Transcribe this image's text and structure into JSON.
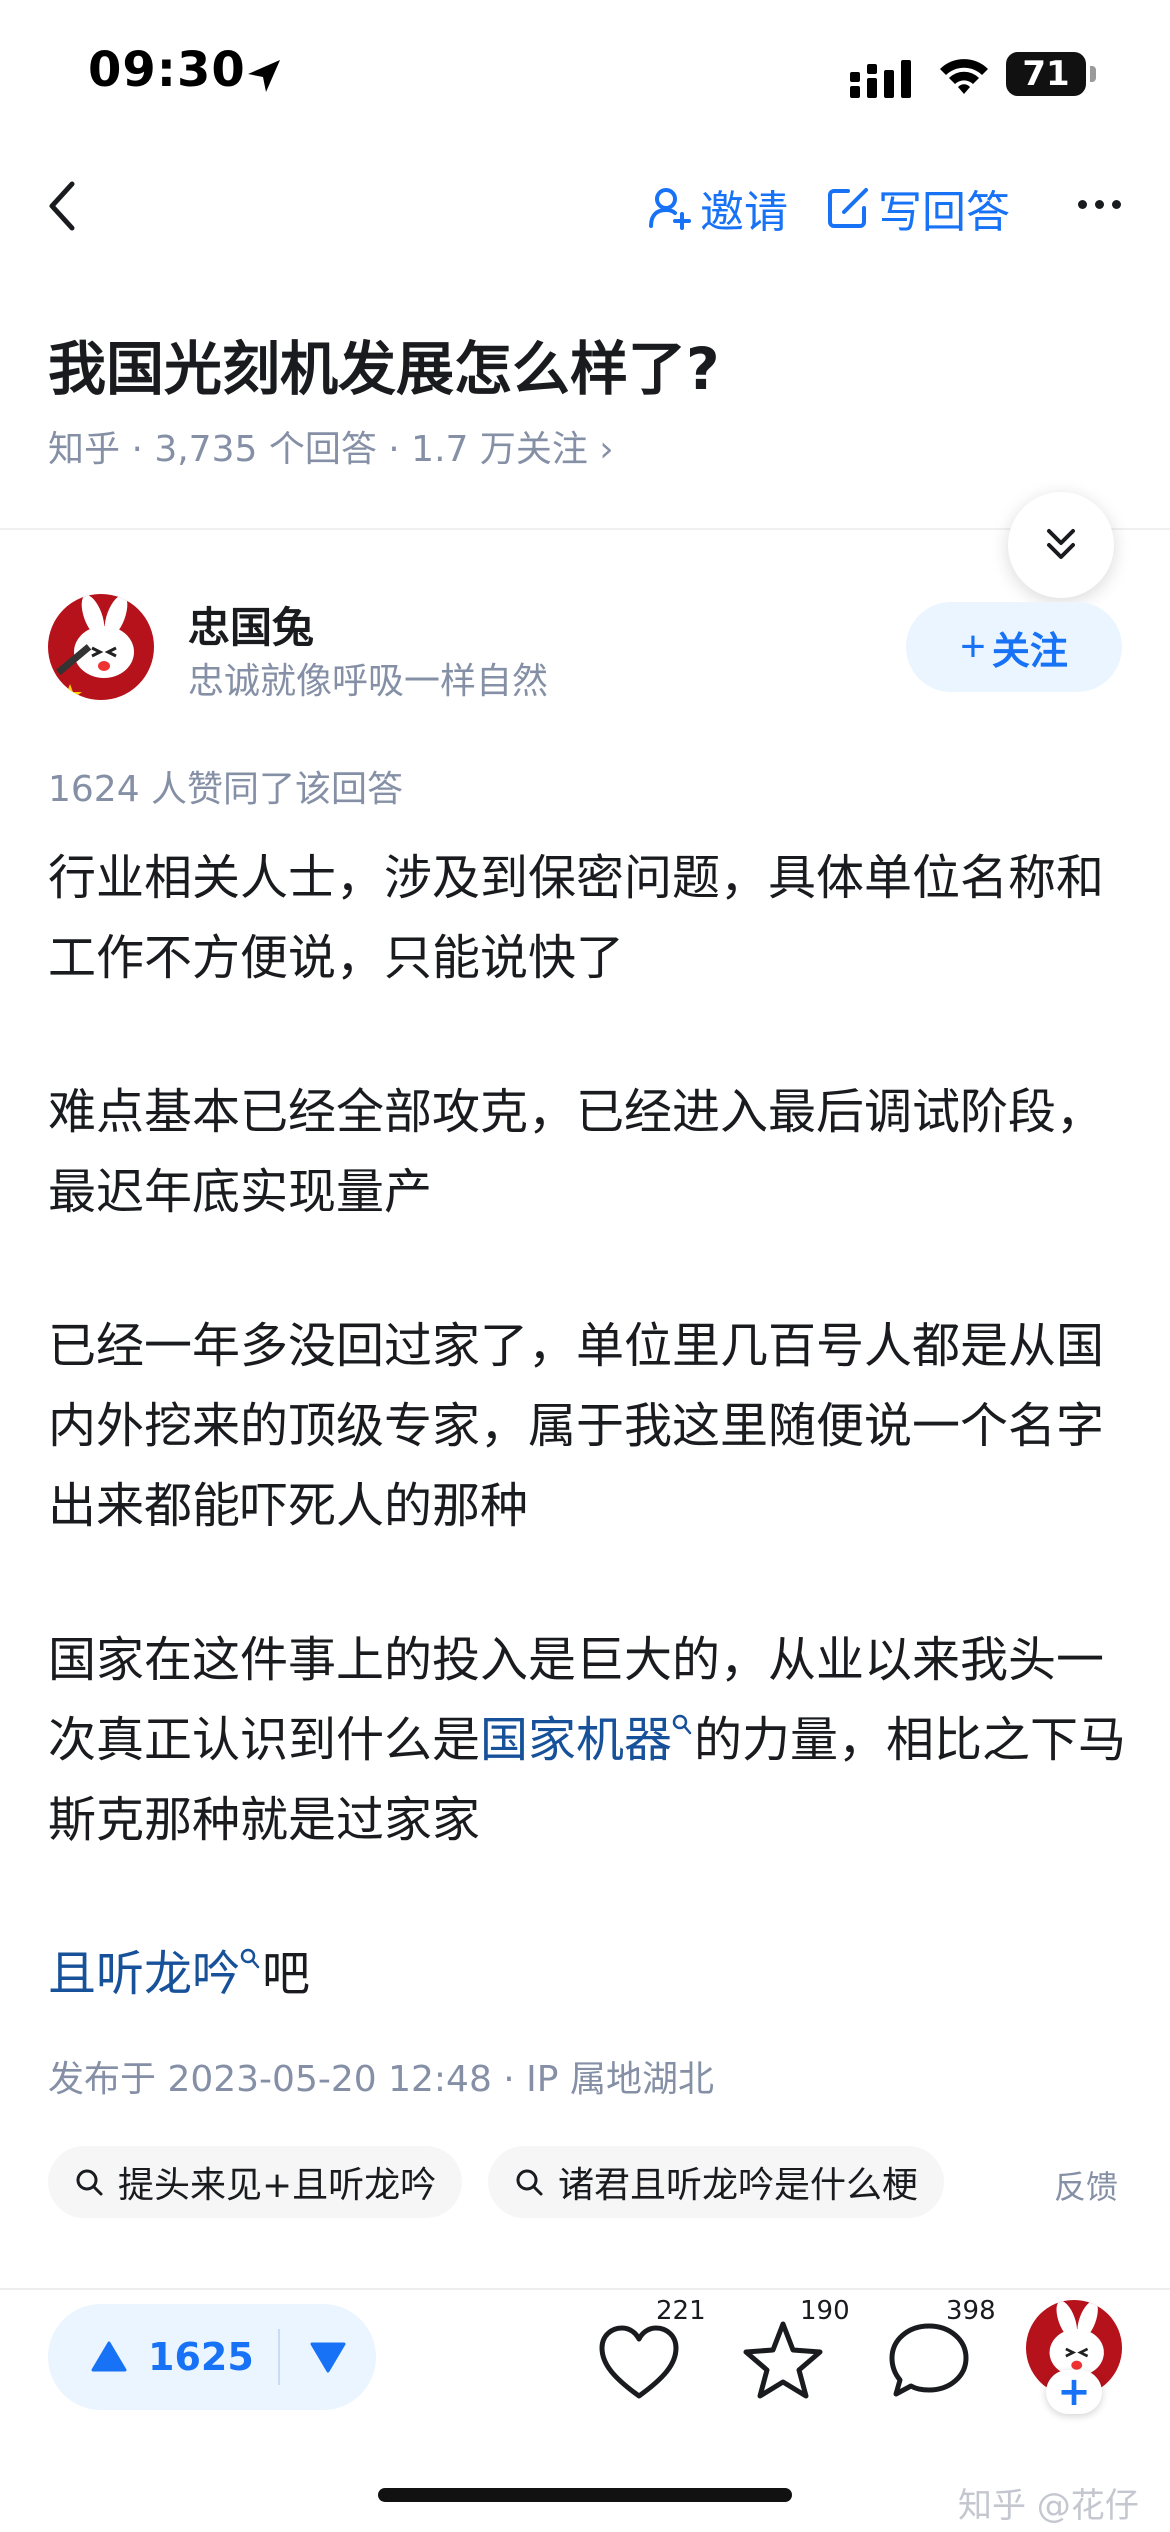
{
  "status_bar": {
    "time": "09:30",
    "battery": "71"
  },
  "nav": {
    "invite": "邀请",
    "write_answer": "写回答"
  },
  "question": {
    "title": "我国光刻机发展怎么样了?",
    "meta": "知乎 · 3,735 个回答 · 1.7 万关注 ›"
  },
  "author": {
    "name": "忠国兔",
    "bio": "忠诚就像呼吸一样自然",
    "follow_label": "关注"
  },
  "answer": {
    "likes_line": "1624 人赞同了该回答",
    "p1": "行业相关人士，涉及到保密问题，具体单位名称和工作不方便说，只能说快了",
    "p2": "难点基本已经全部攻克，已经进入最后调试阶段，最迟年底实现量产",
    "p3": "已经一年多没回过家了，单位里几百号人都是从国内外挖来的顶级专家，属于我这里随便说一个名字出来都能吓死人的那种",
    "p4_a": "国家在这件事上的投入是巨大的，从业以来我头一次真正认识到什么是",
    "p4_link": "国家机器",
    "p4_b": "的力量，相比之下马斯克那种就是过家家",
    "p5_link": "且听龙吟",
    "p5_b": "吧",
    "publish": "发布于 2023-05-20 12:48 · IP 属地湖北"
  },
  "related_searches": [
    "提头来见+且听龙吟",
    "诸君且听龙吟是什么梗"
  ],
  "feedback": "反馈",
  "actions": {
    "upvote_count": "1625",
    "like_count": "221",
    "favorite_count": "190",
    "comment_count": "398"
  },
  "watermark": "知乎 @花仔",
  "colors": {
    "brand_blue": "#1772f6",
    "link_blue": "#175199",
    "meta_gray": "#8590a6"
  }
}
